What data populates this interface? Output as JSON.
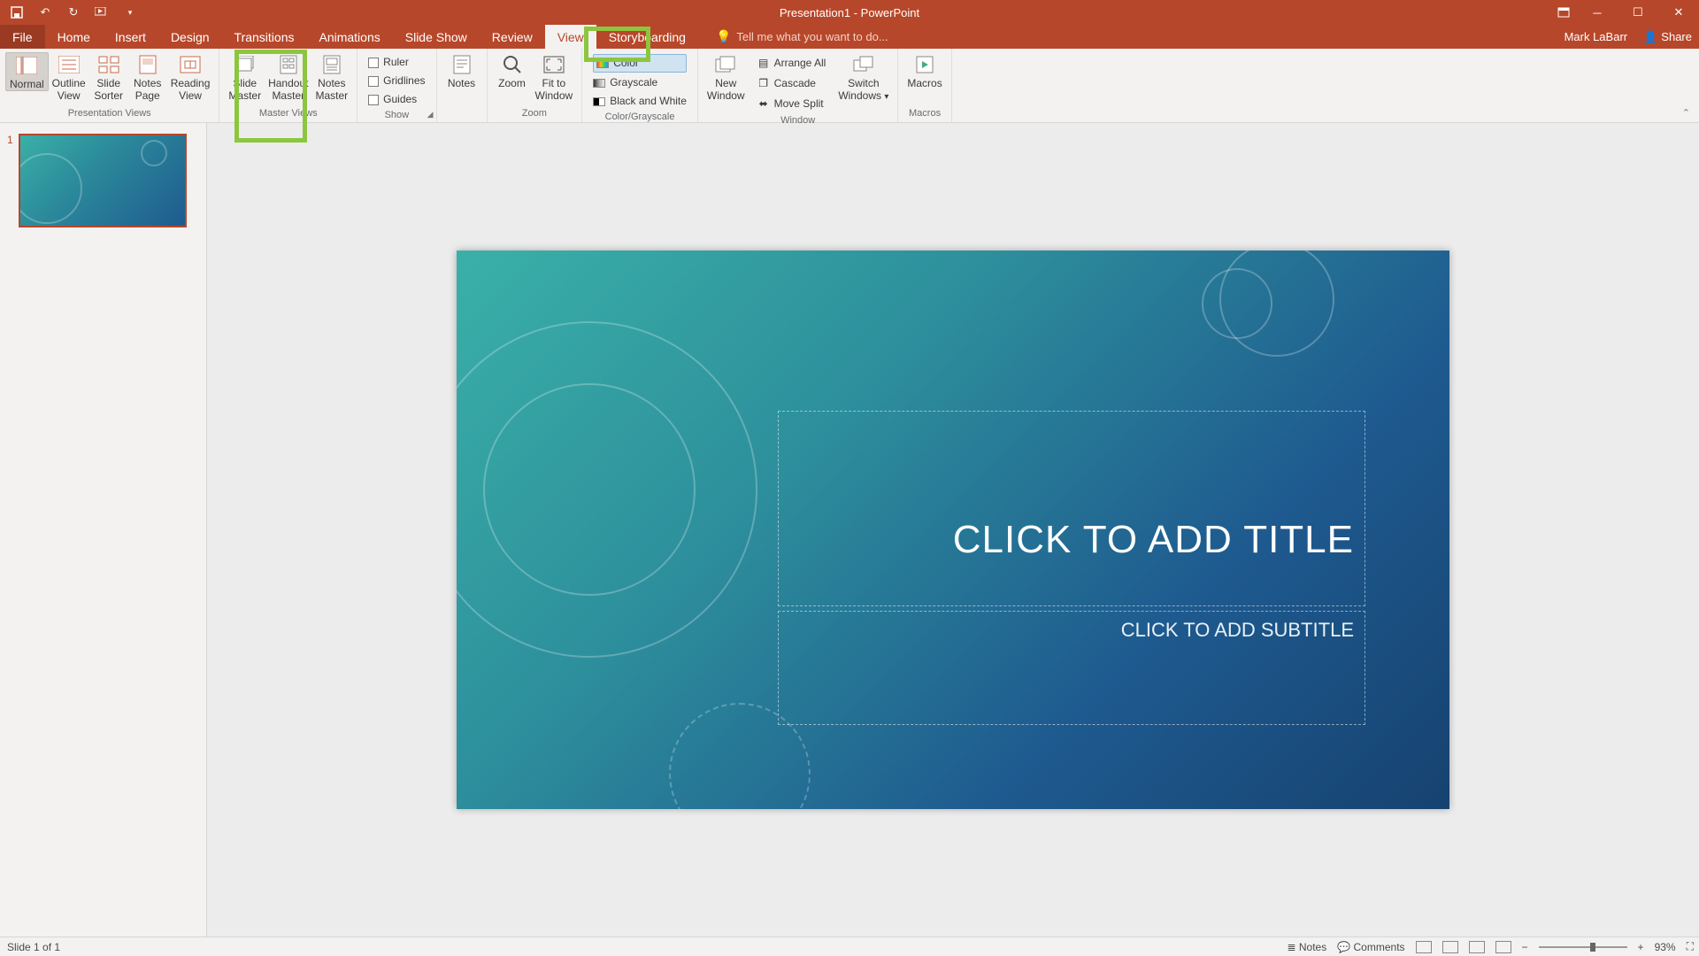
{
  "title": "Presentation1 - PowerPoint",
  "user": "Mark LaBarr",
  "share": "Share",
  "tabs": [
    "File",
    "Home",
    "Insert",
    "Design",
    "Transitions",
    "Animations",
    "Slide Show",
    "Review",
    "View",
    "Storyboarding"
  ],
  "active_tab": "View",
  "tellme": "Tell me what you want to do...",
  "groups": {
    "presentation_views": "Presentation Views",
    "master_views": "Master Views",
    "show": "Show",
    "zoom": "Zoom",
    "color_grayscale": "Color/Grayscale",
    "window": "Window",
    "macros": "Macros"
  },
  "buttons": {
    "normal": "Normal",
    "outline_view_l1": "Outline",
    "outline_view_l2": "View",
    "slide_sorter_l1": "Slide",
    "slide_sorter_l2": "Sorter",
    "notes_page_l1": "Notes",
    "notes_page_l2": "Page",
    "reading_view_l1": "Reading",
    "reading_view_l2": "View",
    "slide_master_l1": "Slide",
    "slide_master_l2": "Master",
    "handout_master_l1": "Handout",
    "handout_master_l2": "Master",
    "notes_master_l1": "Notes",
    "notes_master_l2": "Master",
    "notes": "Notes",
    "zoom": "Zoom",
    "fit_l1": "Fit to",
    "fit_l2": "Window",
    "new_window_l1": "New",
    "new_window_l2": "Window",
    "switch_l1": "Switch",
    "switch_l2": "Windows",
    "macros": "Macros"
  },
  "checks": {
    "ruler": "Ruler",
    "gridlines": "Gridlines",
    "guides": "Guides",
    "color": "Color",
    "grayscale": "Grayscale",
    "bw": "Black and White",
    "arrange_all": "Arrange All",
    "cascade": "Cascade",
    "move_split": "Move Split"
  },
  "slide": {
    "number": "1",
    "title_placeholder": "CLICK TO ADD TITLE",
    "subtitle_placeholder": "CLICK TO ADD SUBTITLE"
  },
  "status": {
    "slide_info": "Slide 1 of 1",
    "notes": "Notes",
    "comments": "Comments",
    "zoom": "93%"
  }
}
